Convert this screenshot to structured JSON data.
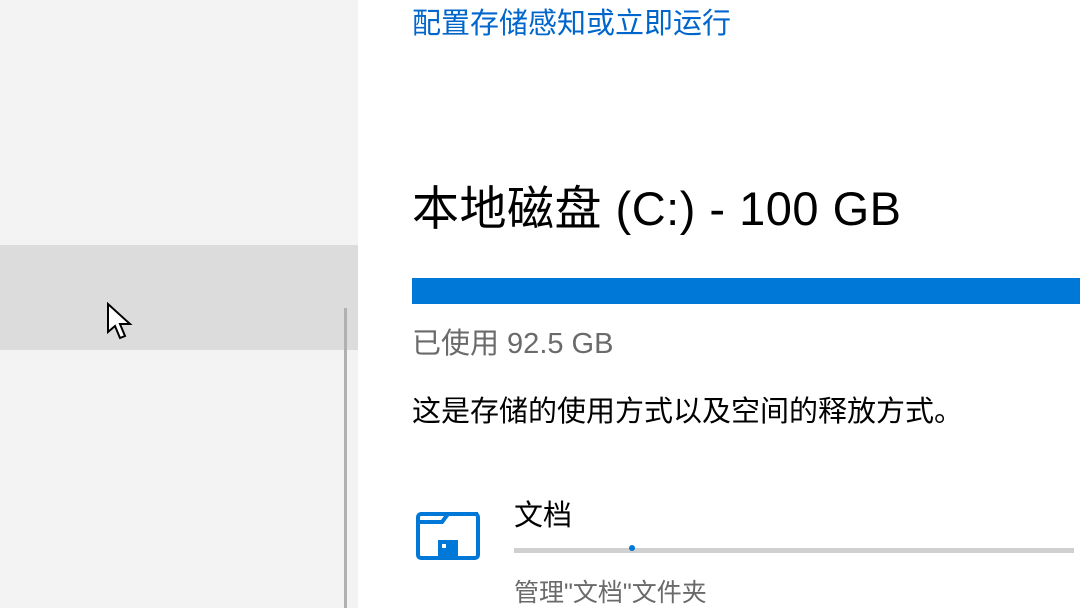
{
  "config_link": "配置存储感知或立即运行",
  "disk": {
    "heading": "本地磁盘 (C:) - 100 GB",
    "used_label": "已使用 92.5 GB"
  },
  "description": "这是存储的使用方式以及空间的释放方式。",
  "category": {
    "title": "文档",
    "subtext": "管理\"文档\"文件夹"
  }
}
